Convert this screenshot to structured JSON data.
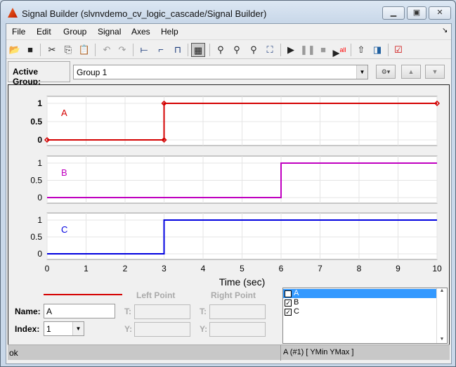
{
  "window": {
    "title": "Signal Builder (slvnvdemo_cv_logic_cascade/Signal Builder)"
  },
  "menu": [
    "File",
    "Edit",
    "Group",
    "Signal",
    "Axes",
    "Help"
  ],
  "active_group": {
    "label": "Active Group:",
    "value": "Group 1"
  },
  "chart_data": [
    {
      "type": "line",
      "name": "A",
      "color": "#d40000",
      "x": [
        0,
        3,
        3,
        10
      ],
      "y": [
        0,
        0,
        1,
        1
      ],
      "ylim": [
        0,
        1
      ],
      "yticks": [
        "0",
        "0.5",
        "1"
      ],
      "markers": true
    },
    {
      "type": "line",
      "name": "B",
      "color": "#c000c0",
      "x": [
        0,
        6,
        6,
        10
      ],
      "y": [
        0,
        0,
        1,
        1
      ],
      "ylim": [
        0,
        1
      ],
      "yticks": [
        "0",
        "0.5",
        "1"
      ]
    },
    {
      "type": "line",
      "name": "C",
      "color": "#0000e0",
      "x": [
        0,
        3,
        3,
        10
      ],
      "y": [
        0,
        0,
        1,
        1
      ],
      "ylim": [
        0,
        1
      ],
      "yticks": [
        "0",
        "0.5",
        "1"
      ]
    }
  ],
  "xaxis": {
    "label": "Time (sec)",
    "xlim": [
      0,
      10
    ],
    "ticks": [
      "0",
      "1",
      "2",
      "3",
      "4",
      "5",
      "6",
      "7",
      "8",
      "9",
      "10"
    ]
  },
  "editor": {
    "left_point": "Left Point",
    "right_point": "Right Point",
    "name_label": "Name:",
    "name_value": "A",
    "index_label": "Index:",
    "index_value": "1",
    "t_label": "T:",
    "y_label": "Y:",
    "line_color": "#d40000"
  },
  "signal_list": [
    {
      "label": "A",
      "checked": true,
      "selected": true
    },
    {
      "label": "B",
      "checked": true
    },
    {
      "label": "C",
      "checked": true
    }
  ],
  "status": {
    "left": "ok",
    "right": "A (#1)  [ YMin YMax ]"
  }
}
